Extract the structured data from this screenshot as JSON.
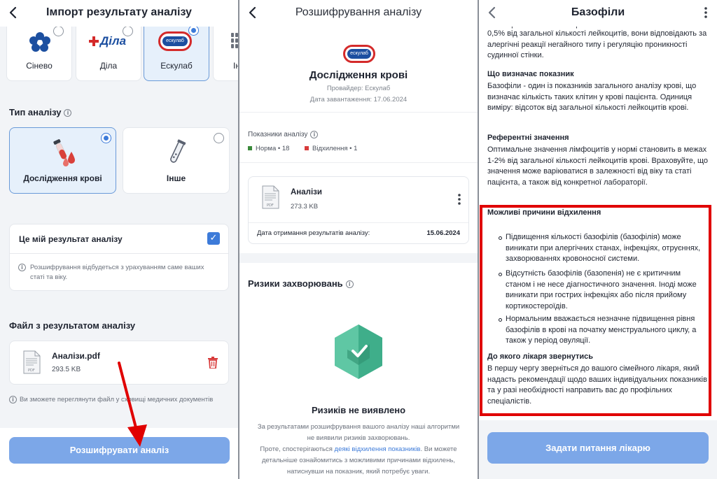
{
  "panel1": {
    "title": "Імпорт результату аналізу",
    "providers": [
      {
        "label": "Сінево",
        "selected": false
      },
      {
        "label": "Діла",
        "selected": false
      },
      {
        "label": "Ескулаб",
        "selected": true
      },
      {
        "label": "Ін",
        "selected": false
      }
    ],
    "dila_logo": "Діла",
    "esc_logo": "ескулаб",
    "type_title": "Тип аналізу",
    "types": [
      {
        "label": "Дослідження крові",
        "selected": true
      },
      {
        "label": "Інше",
        "selected": false
      }
    ],
    "mine_label": "Це мій результат аналізу",
    "mine_checked": true,
    "mine_note": "Розшифрування відбудеться з урахуванням саме ваших статі та віку.",
    "file_title": "Файл з результатом аналізу",
    "file_name": "Аналізи.pdf",
    "file_size": "293.5 KB",
    "foot_note": "Ви зможете переглянути файл у сховищі медичних документів",
    "button": "Розшифрувати аналіз",
    "accent": "#7ca7e8",
    "arrow_color": "#e00000"
  },
  "panel2": {
    "title": "Розшифрування аналізу",
    "logo": "ескулаб",
    "heading": "Дослідження крові",
    "provider": "Провайдер: Ескулаб",
    "uploaded": "Дата завантаження: 17.06.2024",
    "indicators_label": "Показники аналізу",
    "norm": "Норма • 18",
    "deviation": "Відхилення • 1",
    "norm_color": "#3a8a3a",
    "dev_color": "#d83b3b",
    "file_name": "Аналізи",
    "file_size": "273.3 KB",
    "date_label": "Дата отримання результатів аналізу:",
    "date_value": "15.06.2024",
    "risks_title": "Ризики захворювань",
    "no_risk": "Ризиків не виявлено",
    "desc1": "За результатами розшифрування вашого аналізу наші алгоритми не виявили ризиків захворювань.",
    "desc2a": "Проте, спостерігаються ",
    "desc2_link": "деякі відхилення показників",
    "desc2b": ". Ви можете детальніше ознайомитись з можливими причинами відхилень, натиснувши на показник, який потребує уваги."
  },
  "panel3": {
    "title": "Базофіли",
    "intro_cut": "лейкоцитів. Частка базофілів становить всього лише",
    "intro": "0,5% від загальної кількості лейкоцитів, вони відповідають за алергічні реакції негайного типу і регуляцію проникності судинної стінки.",
    "what_h": "Що визначає показник",
    "what": "Базофіли - один із показників загального аналізу крові, що визначає кількість таких клітин у крові пацієнта. Одиниця виміру: відсоток від загальної кількості лейкоцитів крові.",
    "ref_h": "Референтні значення",
    "ref": "Оптимальне значення лімфоцитів у нормі становить в межах 1-2% від загальної кількості лейкоцитів крові. Враховуйте, що значення може варіюватися в залежності від віку та статі пацієнта, а також від конкретної лабораторії.",
    "causes_h": "Можливі причини відхилення",
    "bullets": [
      "Підвищення кількості базофілів (базофілія) може виникати при алергічних станах, інфекціях, отруєннях, захворюваннях кровоносної системи.",
      "Відсутність базофілів (базопенія) не є критичним станом і не несе діагностичного значення. Іноді може виникати при гострих інфекціях або після прийому кортикостероїдів.",
      "Нормальним вважається незначне підвищення рівня базофілів в крові на початку менструального циклу, а також у період овуляції."
    ],
    "doctor_h": "До якого лікаря звернутись",
    "doctor": "В першу чергу зверніться до вашого сімейного лікаря, який надасть рекомендації щодо ваших індивідуальних показників та у разі необхідності направить вас до профільних спеціалістів.",
    "button": "Задати питання лікарю",
    "highlight_color": "#e00000"
  }
}
